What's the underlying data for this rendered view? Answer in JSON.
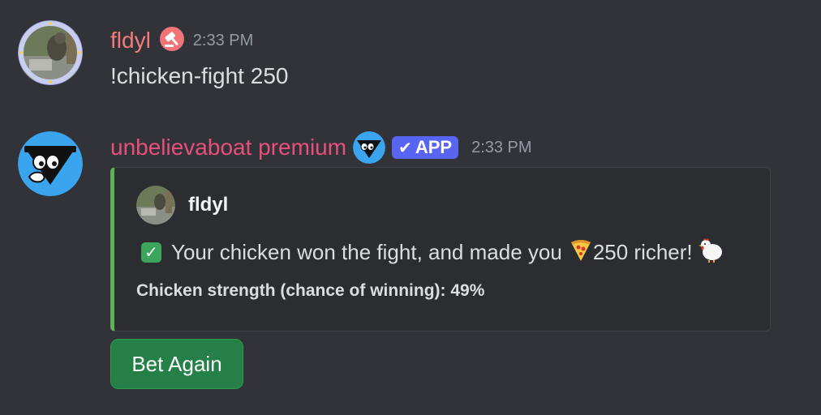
{
  "messages": [
    {
      "author": "fldyl",
      "role_icon": "gavel-role-icon",
      "timestamp": "2:33 PM",
      "content": "!chicken-fight 250",
      "avatar": "user-avatar"
    },
    {
      "author": "unbelievaboat premium",
      "bot_icon": "bot-mini-avatar",
      "badge": "APP",
      "timestamp": "2:33 PM",
      "avatar": "bot-avatar",
      "embed": {
        "accent_color": "#5fb157",
        "author_name": "fldyl",
        "description_before": "Your chicken won the fight, and made you",
        "description_amount": "250 richer!",
        "description_icons": [
          "check-icon",
          "pizza-icon",
          "chicken-icon"
        ],
        "field": "Chicken strength (chance of winning): 49%"
      },
      "button": {
        "label": "Bet Again",
        "color": "#248046"
      }
    }
  ],
  "colors": {
    "background": "#313338",
    "user_name": "#f47b7b",
    "bot_name": "#e6507a",
    "app_badge": "#5865f2"
  }
}
